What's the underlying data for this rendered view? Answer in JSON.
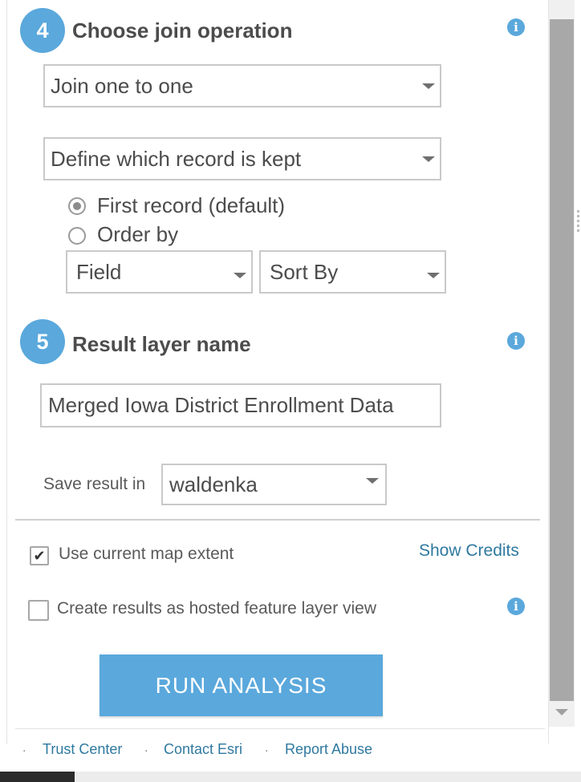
{
  "step4": {
    "number": "4",
    "title": "Choose join operation",
    "info_icon": "info-icon",
    "join_select": "Join one to one",
    "record_select": "Define which record is kept",
    "radio_first": "First record (default)",
    "radio_first_checked": true,
    "radio_order": "Order by",
    "field_select": "Field",
    "sort_select": "Sort By"
  },
  "step5": {
    "number": "5",
    "title": "Result layer name",
    "info_icon": "info-icon",
    "layer_name": "Merged Iowa District Enrollment Data",
    "save_label": "Save result in",
    "save_folder": "waldenka"
  },
  "options": {
    "use_extent_label": "Use current map extent",
    "use_extent_checked": true,
    "show_credits": "Show Credits",
    "hosted_view_label": "Create results as hosted feature layer view",
    "hosted_view_checked": false
  },
  "run_button": "RUN ANALYSIS",
  "footer": {
    "links": [
      "Trust Center",
      "Contact Esri",
      "Report Abuse"
    ]
  },
  "colors": {
    "accent": "#5aa8dc",
    "link": "#2f79a0"
  }
}
